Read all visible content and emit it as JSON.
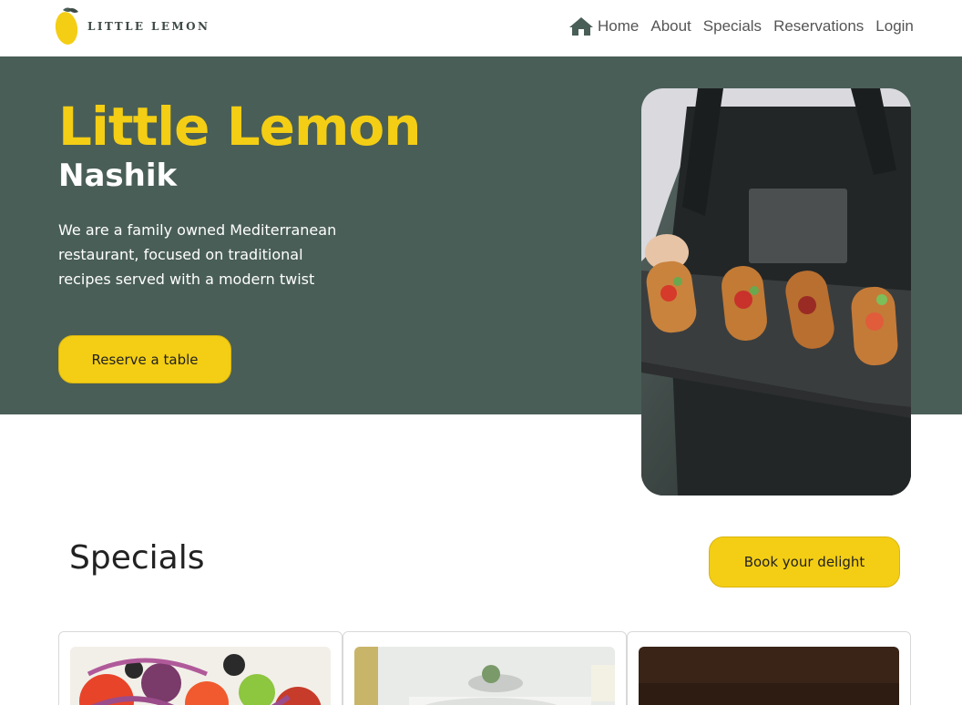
{
  "nav": {
    "logo_text": "LITTLE LEMON",
    "logo_icon": "lemon-icon",
    "home_icon": "home-icon",
    "links": [
      "Home",
      "About",
      "Specials",
      "Reservations",
      "Login"
    ]
  },
  "hero": {
    "title": "Little Lemon",
    "subtitle": "Nashik",
    "description": "We are a family owned Mediterranean restaurant, focused on traditional recipes served with a modern twist",
    "reserve_label": "Reserve a table"
  },
  "specials": {
    "title": "Specials",
    "book_label": "Book your delight"
  },
  "colors": {
    "brand_green": "#495e57",
    "brand_yellow": "#f4ce14"
  }
}
